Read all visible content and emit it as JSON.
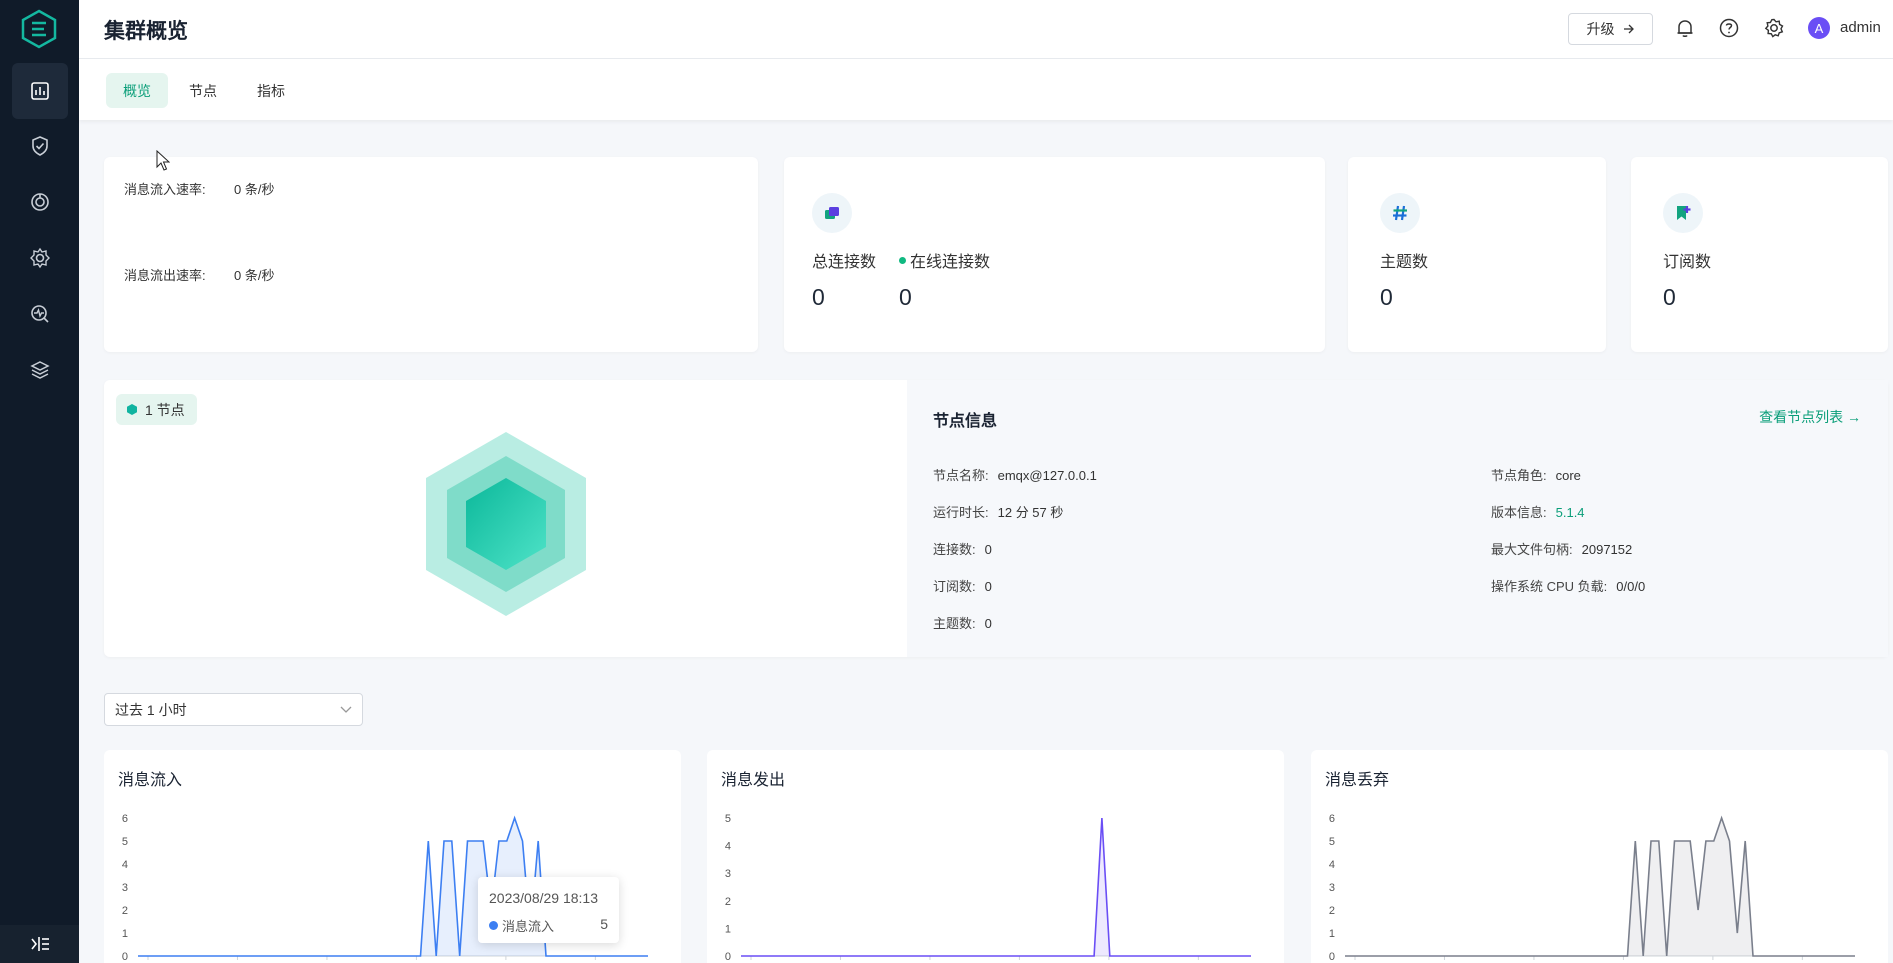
{
  "header": {
    "title": "集群概览",
    "upgrade_label": "升级",
    "user": "admin",
    "avatar_letter": "A"
  },
  "tabs": [
    {
      "label": "概览",
      "active": true
    },
    {
      "label": "节点",
      "active": false
    },
    {
      "label": "指标",
      "active": false
    }
  ],
  "sidebar": {
    "items": [
      {
        "icon": "dashboard-icon",
        "active": true
      },
      {
        "icon": "shield-check-icon",
        "active": false
      },
      {
        "icon": "integration-icon",
        "active": false
      },
      {
        "icon": "gear-settings-icon",
        "active": false
      },
      {
        "icon": "diagnose-icon",
        "active": false
      },
      {
        "icon": "layers-icon",
        "active": false
      }
    ]
  },
  "rates": {
    "in_label": "消息流入速率:",
    "in_value": "0 条/秒",
    "out_label": "消息流出速率:",
    "out_value": "0 条/秒"
  },
  "stats": {
    "total_conn_label": "总连接数",
    "total_conn_value": "0",
    "online_conn_label": "在线连接数",
    "online_conn_value": "0",
    "topics_label": "主题数",
    "topics_value": "0",
    "subs_label": "订阅数",
    "subs_value": "0"
  },
  "nodes": {
    "badge": "1 节点"
  },
  "node_info": {
    "title": "节点信息",
    "link": "查看节点列表",
    "rows_left": [
      {
        "label": "节点名称:",
        "value": "emqx@127.0.0.1"
      },
      {
        "label": "运行时长:",
        "value": "12 分 57 秒"
      },
      {
        "label": "连接数:",
        "value": "0"
      },
      {
        "label": "订阅数:",
        "value": "0"
      },
      {
        "label": "主题数:",
        "value": "0"
      }
    ],
    "rows_right": [
      {
        "label": "节点角色:",
        "value": "core"
      },
      {
        "label": "版本信息:",
        "value": "5.1.4"
      },
      {
        "label": "最大文件句柄:",
        "value": "2097152"
      },
      {
        "label": "操作系统 CPU 负载:",
        "value": "0/0/0"
      }
    ]
  },
  "time_range": "过去 1 小时",
  "colors": {
    "accent": "#0a9e79",
    "sidebar_bg": "#101b29",
    "series_in": "#3d7ff2",
    "series_out": "#6a4ef5",
    "series_drop": "#7a7f8c"
  },
  "tooltip": {
    "date": "2023/08/29 18:13",
    "series": "消息流入",
    "value": "5"
  },
  "chart_data": [
    {
      "type": "area",
      "title": "消息流入",
      "ylim": [
        0,
        6
      ],
      "yticks": [
        "6",
        "5",
        "4",
        "3",
        "2",
        "1",
        "0"
      ],
      "series": [
        {
          "values": [
            0,
            0,
            0,
            0,
            0,
            0,
            0,
            0,
            0,
            0,
            0,
            0,
            0,
            0,
            0,
            0,
            0,
            0,
            0,
            0,
            0,
            0,
            0,
            0,
            0,
            0,
            0,
            0,
            0,
            0,
            0,
            0,
            0,
            0,
            0,
            0,
            0,
            5,
            0,
            5,
            5,
            0,
            5,
            5,
            5,
            2,
            5,
            5,
            6,
            5,
            1,
            5,
            0,
            0,
            0,
            0,
            0,
            0,
            0,
            0,
            0,
            0,
            0,
            0,
            0,
            0
          ]
        }
      ]
    },
    {
      "type": "area",
      "title": "消息发出",
      "ylim": [
        0,
        5
      ],
      "yticks": [
        "5",
        "4",
        "3",
        "2",
        "1",
        "0"
      ],
      "series": [
        {
          "values": [
            0,
            0,
            0,
            0,
            0,
            0,
            0,
            0,
            0,
            0,
            0,
            0,
            0,
            0,
            0,
            0,
            0,
            0,
            0,
            0,
            0,
            0,
            0,
            0,
            0,
            0,
            0,
            0,
            0,
            0,
            0,
            0,
            0,
            0,
            0,
            0,
            0,
            0,
            0,
            0,
            0,
            0,
            0,
            0,
            0,
            0,
            5,
            0,
            0,
            0,
            0,
            0,
            0,
            0,
            0,
            0,
            0,
            0,
            0,
            0,
            0,
            0,
            0,
            0,
            0,
            0
          ]
        }
      ]
    },
    {
      "type": "area",
      "title": "消息丢弃",
      "ylim": [
        0,
        6
      ],
      "yticks": [
        "6",
        "5",
        "4",
        "3",
        "2",
        "1",
        "0"
      ],
      "series": [
        {
          "values": [
            0,
            0,
            0,
            0,
            0,
            0,
            0,
            0,
            0,
            0,
            0,
            0,
            0,
            0,
            0,
            0,
            0,
            0,
            0,
            0,
            0,
            0,
            0,
            0,
            0,
            0,
            0,
            0,
            0,
            0,
            0,
            0,
            0,
            0,
            0,
            0,
            0,
            5,
            0,
            5,
            5,
            0,
            5,
            5,
            5,
            2,
            5,
            5,
            6,
            5,
            1,
            5,
            0,
            0,
            0,
            0,
            0,
            0,
            0,
            0,
            0,
            0,
            0,
            0,
            0,
            0
          ]
        }
      ]
    }
  ]
}
